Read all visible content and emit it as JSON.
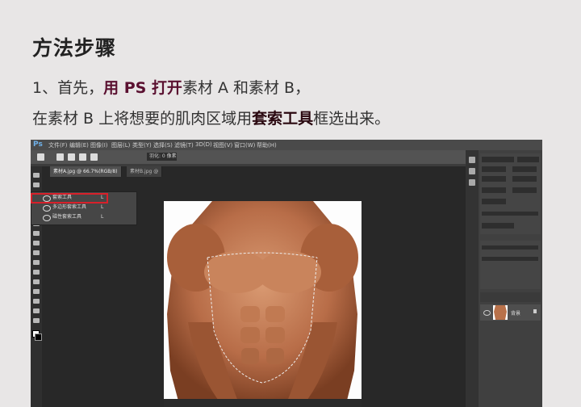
{
  "title": "方法步骤",
  "step1": {
    "prefix": "1、首先，",
    "open_emph": "用 PS 打开",
    "suffix": "素材 A 和素材 B，"
  },
  "step2": {
    "prefix": "在素材 B 上将想要的肌肉区域用",
    "tool_emph": "套索工具",
    "suffix": "框选出来。"
  },
  "photoshop": {
    "logo": "Ps",
    "menu": [
      "文件(F)",
      "编辑(E)",
      "图像(I)",
      "图层(L)",
      "类型(Y)",
      "选择(S)",
      "滤镜(T)",
      "3D(D)",
      "视图(V)",
      "窗口(W)",
      "帮助(H)"
    ],
    "feather_label": "羽化: 0 像素",
    "tabs": [
      "素材A.jpg @ 66.7%(RGB/8)",
      "素材B.jpg @"
    ],
    "popup_items": [
      {
        "label": "套索工具",
        "key": "L"
      },
      {
        "label": "多边形套索工具",
        "key": "L"
      },
      {
        "label": "磁性套索工具",
        "key": "L"
      }
    ],
    "layer_name": "背景",
    "colors": {
      "highlight": "#d8202a",
      "emph": "#5a1030"
    }
  }
}
